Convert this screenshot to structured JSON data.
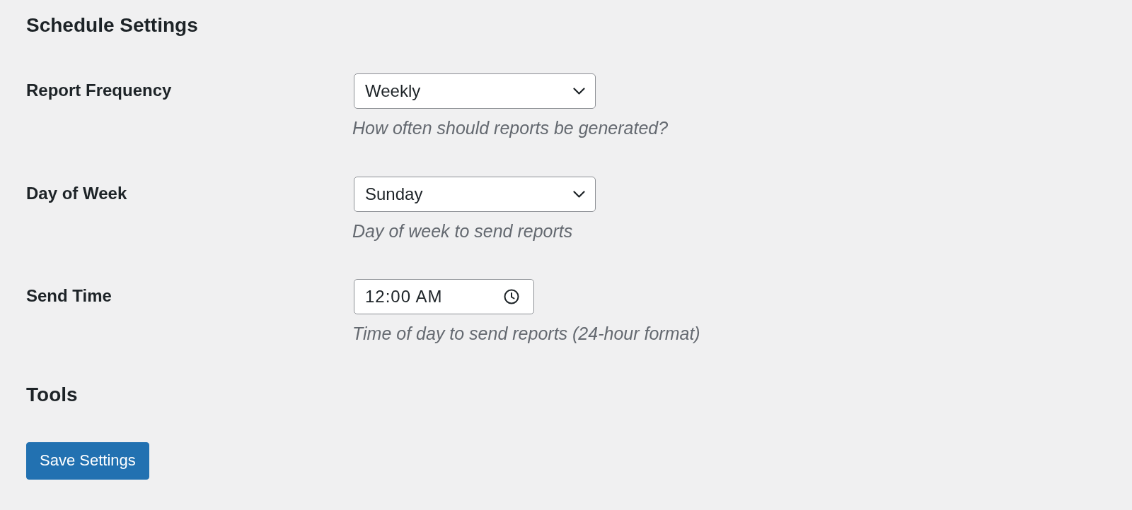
{
  "sections": [
    {
      "title": "Schedule Settings",
      "fields": [
        {
          "kind": "select",
          "label": "Report Frequency",
          "value": "Weekly",
          "description": "How often should reports be generated?"
        },
        {
          "kind": "select",
          "label": "Day of Week",
          "value": "Sunday",
          "description": "Day of week to send reports"
        },
        {
          "kind": "time",
          "label": "Send Time",
          "value": "12:00 AM",
          "description": "Time of day to send reports (24-hour format)"
        }
      ]
    },
    {
      "title": "Tools"
    }
  ],
  "save_button": {
    "label": "Save Settings"
  }
}
